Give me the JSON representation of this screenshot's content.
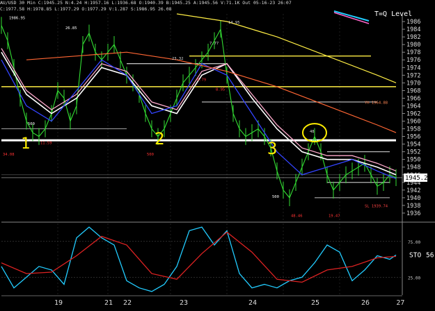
{
  "header": {
    "line1": "AU/USD 30 Min  C:1945.25  N:4.24  H:1957.16  L:1936.68  O:1940.39  B:1945.25  A:1945.56  V:71.1K  Out  05-16-23  26:07",
    "line2": "C:1977.58  H:1978.85  L:1977.29  O:1977.29  V:1.287  S:1986.95  26.08"
  },
  "annotations": {
    "tq_level": "T=Q Level",
    "current_price": "1945.25",
    "yh_label": "YH 1964.88",
    "sl_label": "SL 1939.74",
    "stoch_label": "STO",
    "stoch_value": "56",
    "hand_1": "1",
    "hand_2": "2",
    "hand_3": "3",
    "swing_labels": [
      "1986.95",
      "26.85",
      "14.95",
      "7.77",
      "23.32",
      "4.79",
      "8.95",
      "500",
      "11.59",
      "500",
      "34.08",
      "48",
      "500",
      "48.46",
      "19.47"
    ]
  },
  "colors": {
    "background": "#000000",
    "price": "#33dd33",
    "white_ma": "#ffffff",
    "pink_ma": "#ffaacc",
    "blue_ma": "#3344ff",
    "yellow_line": "#ffee44",
    "orange_ma": "#ff6633",
    "stoch_fast": "#22ccff",
    "stoch_slow": "#dd2222",
    "annotation_yellow": "#ffee00",
    "red_text": "#ff3333"
  },
  "chart_data": [
    {
      "type": "line",
      "title": "AU/USD 30 Min",
      "ylim": [
        1934,
        1988
      ],
      "y_ticks": [
        1936,
        1938,
        1940,
        1942,
        1944,
        1946,
        1948,
        1950,
        1952,
        1954,
        1956,
        1958,
        1960,
        1962,
        1964,
        1966,
        1968,
        1970,
        1972,
        1974,
        1976,
        1978,
        1980,
        1982,
        1984,
        1986
      ],
      "x_tick_labels": [
        "19",
        "21",
        "22",
        "23",
        "24",
        "25",
        "26",
        "27"
      ],
      "support_level": 1955,
      "current_price": 1945.25,
      "series": [
        {
          "key": "price",
          "x": [
            0,
            1,
            2,
            3,
            4,
            5,
            6,
            7,
            8,
            9,
            10,
            11,
            12,
            13,
            14,
            15,
            16,
            17,
            18,
            19,
            20,
            21,
            22,
            23,
            24,
            25,
            26,
            27,
            28,
            29,
            30,
            31,
            32,
            33,
            34,
            35,
            36,
            37,
            38,
            39,
            40,
            41,
            42,
            43,
            44,
            45,
            46,
            47,
            48,
            49,
            50,
            51,
            52,
            53,
            54,
            55,
            56,
            57,
            58,
            59,
            60,
            61,
            62,
            63
          ],
          "y": [
            1985,
            1981,
            1974,
            1966,
            1960,
            1957,
            1956,
            1958,
            1962,
            1968,
            1966,
            1960,
            1964,
            1980,
            1983,
            1978,
            1976,
            1978,
            1980,
            1976,
            1972,
            1970,
            1967,
            1962,
            1958,
            1956,
            1958,
            1962,
            1966,
            1970,
            1972,
            1974,
            1976,
            1978,
            1981,
            1984,
            1972,
            1962,
            1958,
            1956,
            1957,
            1958,
            1956,
            1953,
            1947,
            1942,
            1940,
            1944,
            1948,
            1952,
            1956,
            1952,
            1946,
            1942,
            1944,
            1946,
            1947,
            1948,
            1949,
            1946,
            1943,
            1944,
            1946,
            1945.25
          ]
        },
        {
          "key": "white_ma",
          "x": [
            0,
            4,
            8,
            12,
            16,
            20,
            24,
            28,
            32,
            36,
            40,
            44,
            48,
            52,
            56,
            60,
            63
          ],
          "y": [
            1978,
            1967,
            1962,
            1966,
            1974,
            1972,
            1964,
            1962,
            1972,
            1975,
            1966,
            1958,
            1952,
            1950,
            1950,
            1948,
            1946
          ]
        },
        {
          "key": "pink_ma",
          "x": [
            0,
            4,
            8,
            12,
            16,
            20,
            24,
            28,
            32,
            36,
            40,
            44,
            48,
            52,
            56,
            60,
            63
          ],
          "y": [
            1979,
            1968,
            1963,
            1967,
            1975,
            1973,
            1965,
            1963,
            1973,
            1975,
            1967,
            1959,
            1953,
            1951,
            1951,
            1949,
            1947
          ]
        },
        {
          "key": "blue_ma",
          "x": [
            0,
            4,
            8,
            12,
            16,
            20,
            24,
            28,
            32,
            36,
            40,
            44,
            48,
            52,
            56,
            60,
            63
          ],
          "y": [
            1976,
            1964,
            1960,
            1968,
            1976,
            1972,
            1962,
            1964,
            1975,
            1972,
            1962,
            1952,
            1946,
            1948,
            1950,
            1947,
            1945
          ]
        },
        {
          "key": "orange_ma",
          "x": [
            4,
            12,
            20,
            28,
            36,
            44,
            52,
            60,
            63
          ],
          "y": [
            1976,
            1977,
            1978,
            1976,
            1973,
            1969,
            1964,
            1959,
            1957
          ]
        },
        {
          "key": "yellow_line",
          "x": [
            28,
            36,
            44,
            52,
            60,
            63
          ],
          "y": [
            1988,
            1986,
            1982,
            1977,
            1972,
            1970
          ]
        }
      ]
    },
    {
      "type": "line",
      "title": "STO",
      "ylim": [
        0,
        100
      ],
      "y_ticks": [
        25,
        75
      ],
      "current_value": 56,
      "series": [
        {
          "key": "stoch_fast",
          "x": [
            0,
            2,
            4,
            6,
            8,
            10,
            12,
            14,
            16,
            18,
            20,
            22,
            24,
            26,
            28,
            30,
            32,
            34,
            36,
            38,
            40,
            42,
            44,
            46,
            48,
            50,
            52,
            54,
            56,
            58,
            60,
            62,
            63
          ],
          "y": [
            40,
            10,
            25,
            40,
            35,
            15,
            80,
            95,
            80,
            70,
            20,
            10,
            5,
            15,
            40,
            90,
            95,
            70,
            90,
            30,
            10,
            15,
            10,
            20,
            25,
            45,
            70,
            60,
            20,
            35,
            55,
            50,
            56
          ]
        },
        {
          "key": "stoch_slow",
          "x": [
            0,
            4,
            8,
            12,
            16,
            20,
            24,
            28,
            32,
            36,
            40,
            44,
            48,
            52,
            56,
            60,
            63
          ],
          "y": [
            45,
            30,
            32,
            55,
            82,
            70,
            30,
            22,
            58,
            88,
            60,
            22,
            18,
            35,
            40,
            52,
            54
          ]
        }
      ]
    }
  ]
}
